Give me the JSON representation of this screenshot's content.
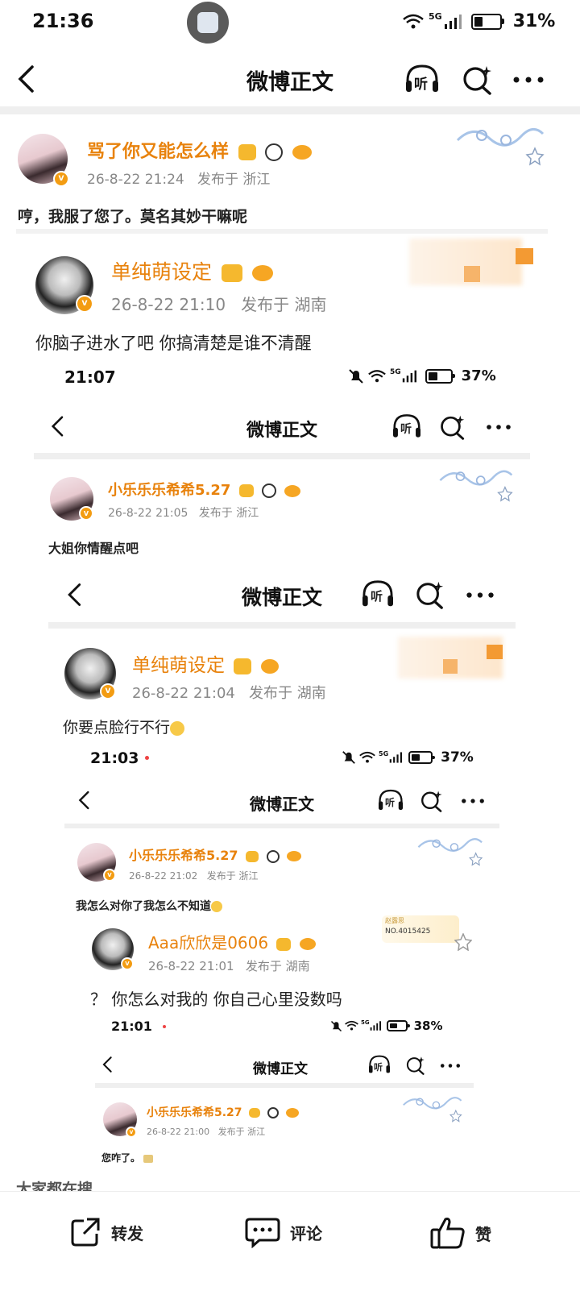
{
  "status_bar": {
    "time": "21:36",
    "network": "5G",
    "battery": "31%"
  },
  "header": {
    "title": "微博正文",
    "listen_label": "听"
  },
  "post": {
    "username": "骂了你又能怎么样",
    "date": "26-8-22 21:24",
    "location": "发布于 浙江",
    "text": "哼，我服了您了。莫名其妙干嘛呢"
  },
  "l1": {
    "username": "单纯萌设定",
    "date": "26-8-22 21:10",
    "location": "发布于 湖南",
    "text": "你脑子进水了吧 你搞清楚是谁不清醒",
    "status_time": "21:07",
    "status_network": "5G",
    "status_battery": "37%",
    "header_title": "微博正文",
    "listen_label": "听"
  },
  "l2": {
    "username": "小乐乐乐希希5.27",
    "date": "26-8-22 21:05",
    "location": "发布于 浙江",
    "text": "大姐你情醒点吧",
    "header_title": "微博正文",
    "listen_label": "听"
  },
  "l3": {
    "username": "单纯萌设定",
    "date": "26-8-22 21:04",
    "location": "发布于 湖南",
    "text": "你要点脸行不行",
    "status_time": "21:03",
    "status_network": "5G",
    "status_battery": "37%",
    "header_title": "微博正文",
    "listen_label": "听"
  },
  "l4": {
    "username": "小乐乐乐希希5.27",
    "date": "26-8-22 21:02",
    "location": "发布于 浙江",
    "text": "我怎么对你了我怎么不知道"
  },
  "l5": {
    "username": "Aaa欣欣是0606",
    "date": "26-8-22 21:01",
    "location": "发布于 湖南",
    "text": "？ 你怎么对我的 你自己心里没数吗",
    "badge_name": "赵露思",
    "badge_no": "NO.4015425",
    "status_time": "21:01",
    "status_network": "5G",
    "status_battery": "38%",
    "header_title": "微博正文",
    "listen_label": "听"
  },
  "l6": {
    "username": "小乐乐乐希希5.27",
    "date": "26-8-22 21:00",
    "location": "发布于 浙江",
    "text": "您咋了。"
  },
  "cutoff_text": "大家都在搜",
  "bottom": {
    "repost": "转发",
    "comment": "评论",
    "like": "赞"
  },
  "colors": {
    "accent": "#e8820c",
    "verified": "#f39c12",
    "meta": "#888888"
  }
}
